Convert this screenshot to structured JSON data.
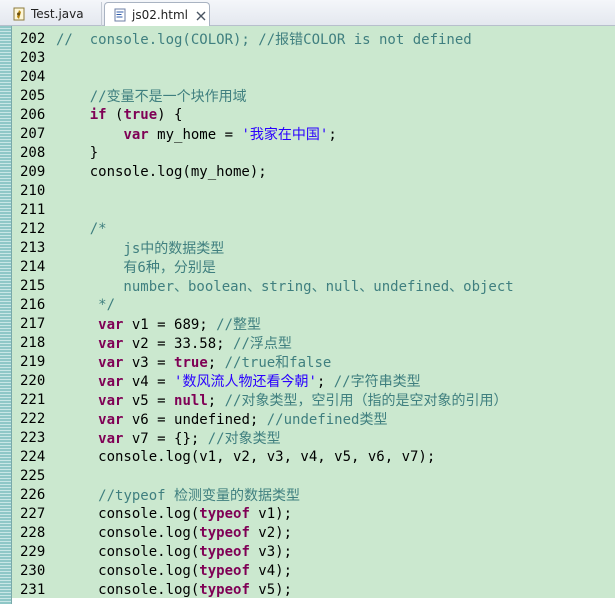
{
  "tabs": [
    {
      "label": "Test.java",
      "icon": "java-file-icon",
      "active": false
    },
    {
      "label": "js02.html",
      "icon": "html-file-icon",
      "active": true
    }
  ],
  "colors": {
    "editor_background": "#cbe8cf",
    "comment": "#3f7f7f",
    "keyword": "#7f0055",
    "string": "#2a00ff"
  },
  "editor": {
    "lines": [
      {
        "num": "202",
        "tokens": [
          {
            "t": "c",
            "v": "//  console.log(COLOR); //报错COLOR is not defined"
          }
        ]
      },
      {
        "num": "203",
        "tokens": []
      },
      {
        "num": "204",
        "tokens": []
      },
      {
        "num": "205",
        "tokens": [
          {
            "t": "p",
            "v": "    "
          },
          {
            "t": "c",
            "v": "//变量不是一个块作用域"
          }
        ]
      },
      {
        "num": "206",
        "tokens": [
          {
            "t": "p",
            "v": "    "
          },
          {
            "t": "k",
            "v": "if"
          },
          {
            "t": "p",
            "v": " ("
          },
          {
            "t": "k",
            "v": "true"
          },
          {
            "t": "p",
            "v": ") {"
          }
        ]
      },
      {
        "num": "207",
        "tokens": [
          {
            "t": "p",
            "v": "        "
          },
          {
            "t": "k",
            "v": "var"
          },
          {
            "t": "p",
            "v": " my_home = "
          },
          {
            "t": "s",
            "v": "'我家在中国'"
          },
          {
            "t": "p",
            "v": ";"
          }
        ]
      },
      {
        "num": "208",
        "tokens": [
          {
            "t": "p",
            "v": "    }"
          }
        ]
      },
      {
        "num": "209",
        "tokens": [
          {
            "t": "p",
            "v": "    console.log(my_home);"
          }
        ]
      },
      {
        "num": "210",
        "tokens": []
      },
      {
        "num": "211",
        "tokens": []
      },
      {
        "num": "212",
        "tokens": [
          {
            "t": "p",
            "v": "    "
          },
          {
            "t": "c",
            "v": "/*"
          }
        ]
      },
      {
        "num": "213",
        "tokens": [
          {
            "t": "c",
            "v": "        js中的数据类型"
          }
        ]
      },
      {
        "num": "214",
        "tokens": [
          {
            "t": "c",
            "v": "        有6种，分别是"
          }
        ]
      },
      {
        "num": "215",
        "tokens": [
          {
            "t": "c",
            "v": "        number、boolean、string、null、undefined、object"
          }
        ]
      },
      {
        "num": "216",
        "tokens": [
          {
            "t": "c",
            "v": "     */"
          }
        ]
      },
      {
        "num": "217",
        "tokens": [
          {
            "t": "p",
            "v": "     "
          },
          {
            "t": "k",
            "v": "var"
          },
          {
            "t": "p",
            "v": " v1 = 689; "
          },
          {
            "t": "c",
            "v": "//整型"
          }
        ]
      },
      {
        "num": "218",
        "tokens": [
          {
            "t": "p",
            "v": "     "
          },
          {
            "t": "k",
            "v": "var"
          },
          {
            "t": "p",
            "v": " v2 = 33.58; "
          },
          {
            "t": "c",
            "v": "//浮点型"
          }
        ]
      },
      {
        "num": "219",
        "tokens": [
          {
            "t": "p",
            "v": "     "
          },
          {
            "t": "k",
            "v": "var"
          },
          {
            "t": "p",
            "v": " v3 = "
          },
          {
            "t": "k",
            "v": "true"
          },
          {
            "t": "p",
            "v": "; "
          },
          {
            "t": "c",
            "v": "//true和false"
          }
        ]
      },
      {
        "num": "220",
        "tokens": [
          {
            "t": "p",
            "v": "     "
          },
          {
            "t": "k",
            "v": "var"
          },
          {
            "t": "p",
            "v": " v4 = "
          },
          {
            "t": "s",
            "v": "'数风流人物还看今朝'"
          },
          {
            "t": "p",
            "v": "; "
          },
          {
            "t": "c",
            "v": "//字符串类型"
          }
        ]
      },
      {
        "num": "221",
        "tokens": [
          {
            "t": "p",
            "v": "     "
          },
          {
            "t": "k",
            "v": "var"
          },
          {
            "t": "p",
            "v": " v5 = "
          },
          {
            "t": "k",
            "v": "null"
          },
          {
            "t": "p",
            "v": "; "
          },
          {
            "t": "c",
            "v": "//对象类型，空引用（指的是空对象的引用）"
          }
        ]
      },
      {
        "num": "222",
        "tokens": [
          {
            "t": "p",
            "v": "     "
          },
          {
            "t": "k",
            "v": "var"
          },
          {
            "t": "p",
            "v": " v6 = undefined; "
          },
          {
            "t": "c",
            "v": "//undefined类型"
          }
        ]
      },
      {
        "num": "223",
        "tokens": [
          {
            "t": "p",
            "v": "     "
          },
          {
            "t": "k",
            "v": "var"
          },
          {
            "t": "p",
            "v": " v7 = {}; "
          },
          {
            "t": "c",
            "v": "//对象类型"
          }
        ]
      },
      {
        "num": "224",
        "tokens": [
          {
            "t": "p",
            "v": "     console.log(v1, v2, v3, v4, v5, v6, v7);"
          }
        ]
      },
      {
        "num": "225",
        "tokens": []
      },
      {
        "num": "226",
        "tokens": [
          {
            "t": "p",
            "v": "     "
          },
          {
            "t": "c",
            "v": "//typeof 检测变量的数据类型"
          }
        ]
      },
      {
        "num": "227",
        "tokens": [
          {
            "t": "p",
            "v": "     console.log("
          },
          {
            "t": "k",
            "v": "typeof"
          },
          {
            "t": "p",
            "v": " v1);"
          }
        ]
      },
      {
        "num": "228",
        "tokens": [
          {
            "t": "p",
            "v": "     console.log("
          },
          {
            "t": "k",
            "v": "typeof"
          },
          {
            "t": "p",
            "v": " v2);"
          }
        ]
      },
      {
        "num": "229",
        "tokens": [
          {
            "t": "p",
            "v": "     console.log("
          },
          {
            "t": "k",
            "v": "typeof"
          },
          {
            "t": "p",
            "v": " v3);"
          }
        ]
      },
      {
        "num": "230",
        "tokens": [
          {
            "t": "p",
            "v": "     console.log("
          },
          {
            "t": "k",
            "v": "typeof"
          },
          {
            "t": "p",
            "v": " v4);"
          }
        ]
      },
      {
        "num": "231",
        "tokens": [
          {
            "t": "p",
            "v": "     console.log("
          },
          {
            "t": "k",
            "v": "typeof"
          },
          {
            "t": "p",
            "v": " v5);"
          }
        ]
      }
    ]
  }
}
